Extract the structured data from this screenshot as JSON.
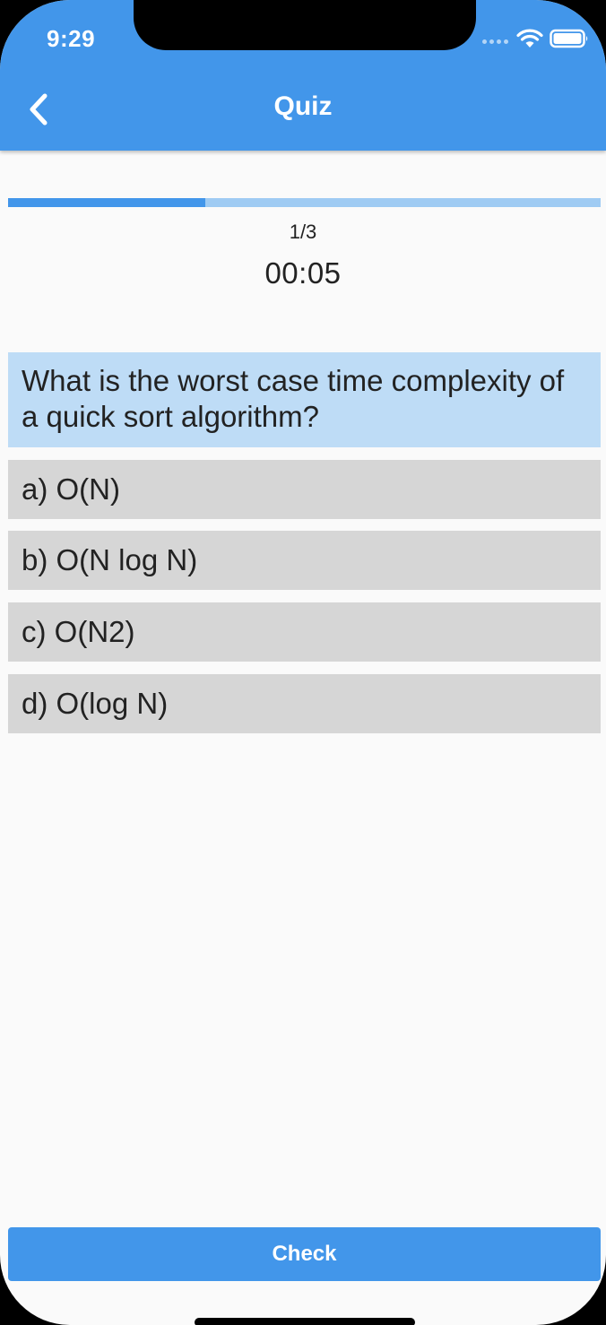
{
  "status_bar": {
    "time": "9:29",
    "wifi_icon": "wifi-icon",
    "battery_icon": "battery-icon"
  },
  "app_bar": {
    "title": "Quiz",
    "back_icon": "chevron-left-icon",
    "color": "#4296ea"
  },
  "progress": {
    "fraction": 0.333,
    "counter": "1/3",
    "timer": "00:05"
  },
  "question": {
    "text": "What is the worst case time complexity of a quick sort algorithm?"
  },
  "options": [
    {
      "label": "a) O(N)"
    },
    {
      "label": "b) O(N log N)"
    },
    {
      "label": "c) O(N2)"
    },
    {
      "label": "d) O(log N)"
    }
  ],
  "check_button": {
    "label": "Check"
  },
  "colors": {
    "accent": "#4296ea",
    "progress_track": "#9fcbf3",
    "question_bg": "#bedcf6",
    "option_bg": "#d6d6d6"
  }
}
